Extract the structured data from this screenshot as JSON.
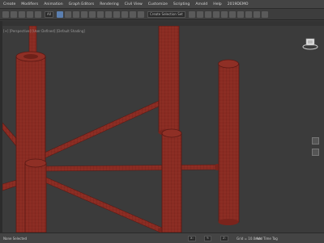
{
  "menubar": {
    "items": [
      "Create",
      "Modifiers",
      "Animation",
      "Graph Editors",
      "Rendering",
      "Civil View",
      "Customize",
      "Scripting",
      "Arnold",
      "Help",
      "2019DEMO"
    ]
  },
  "toolbar": {
    "select_filter": "All",
    "selection_set": "Create Selection Set"
  },
  "viewport": {
    "label": "[+] [Perspective] [User Defined] [Default Shading]"
  },
  "status": {
    "left_text": "None Selected",
    "right_text": "Add Time Tag",
    "coords": [
      "X:",
      "Y:",
      "Z:",
      "Grid = 10.0mm"
    ]
  },
  "colors": {
    "pipe": "#8a2b22",
    "background": "#3a3a3a",
    "accent": "#5b7fb0"
  }
}
